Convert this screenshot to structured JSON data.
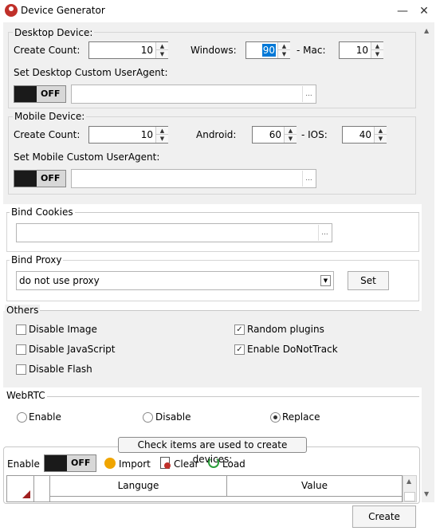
{
  "window": {
    "title": "Device Generator",
    "minimize": "—",
    "close": "✕"
  },
  "desktop": {
    "legend": "Desktop Device:",
    "create_count_label": "Create Count:",
    "create_count": "10",
    "windows_label": "Windows:",
    "windows_value": "90",
    "mac_label": "- Mac:",
    "mac_value": "10",
    "ua_label": "Set Desktop Custom UserAgent:",
    "ua_toggle": "OFF",
    "ua_value": "",
    "browse": "..."
  },
  "mobile": {
    "legend": "Mobile Device:",
    "create_count_label": "Create Count:",
    "create_count": "10",
    "android_label": "Android:",
    "android_value": "60",
    "ios_label": "- IOS:",
    "ios_value": "40",
    "ua_label": "Set Mobile Custom UserAgent:",
    "ua_toggle": "OFF",
    "ua_value": "",
    "browse": "..."
  },
  "bind_cookies": {
    "legend": "Bind Cookies",
    "value": "",
    "browse": "..."
  },
  "bind_proxy": {
    "legend": "Bind Proxy",
    "selected": "do not use proxy",
    "set_label": "Set"
  },
  "others": {
    "legend": "Others",
    "options": [
      {
        "label": "Disable Image",
        "checked": false
      },
      {
        "label": "Disable JavaScript",
        "checked": false
      },
      {
        "label": "Disable Flash",
        "checked": false
      },
      {
        "label": "Random plugins",
        "checked": true
      },
      {
        "label": "Enable DoNotTrack",
        "checked": true
      }
    ],
    "check_glyph": "✓"
  },
  "webrtc": {
    "legend": "WebRTC",
    "options": [
      {
        "label": "Enable",
        "selected": false
      },
      {
        "label": "Disable",
        "selected": false
      },
      {
        "label": "Replace",
        "selected": true
      }
    ]
  },
  "items": {
    "tooltip": "Check items are used to create devices:",
    "enable_label": "Enable",
    "toggle": "OFF",
    "import_label": "Import",
    "clear_label": "Clear",
    "load_label": "Load",
    "columns": [
      "Languge",
      "Value"
    ]
  },
  "footer": {
    "create_label": "Create"
  },
  "colors": {
    "accent": "#0078d7",
    "import_icon": "#f0a500",
    "clear_icon": "#c0302a",
    "load_icon": "#2a9d3a"
  }
}
